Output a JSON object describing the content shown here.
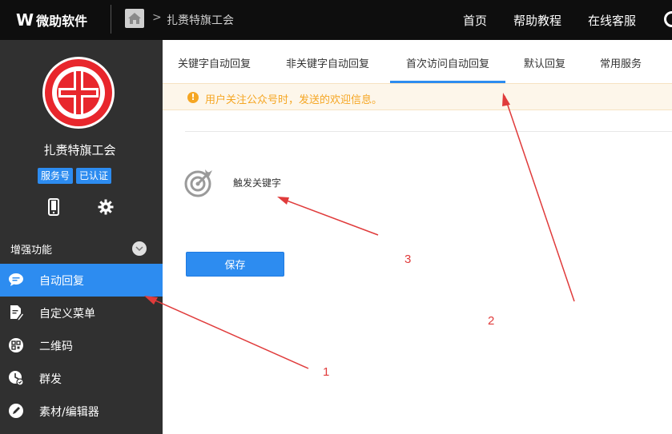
{
  "topbar": {
    "logo_mark": "W",
    "logo_text": "微助软件",
    "breadcrumb_sep": ">",
    "breadcrumb_text": "扎赉特旗工会",
    "nav": [
      "首页",
      "帮助教程",
      "在线客服"
    ]
  },
  "sidebar": {
    "org_name": "扎赉特旗工会",
    "badges": [
      "服务号",
      "已认证"
    ],
    "section_label": "增强功能",
    "menu": [
      {
        "label": "自动回复",
        "icon": "chat-icon",
        "active": true
      },
      {
        "label": "自定义菜单",
        "icon": "edit-doc-icon",
        "active": false
      },
      {
        "label": "二维码",
        "icon": "qrcode-icon",
        "active": false
      },
      {
        "label": "群发",
        "icon": "clock-send-icon",
        "active": false
      },
      {
        "label": "素材/编辑器",
        "icon": "pencil-icon",
        "active": false
      }
    ]
  },
  "tabs": [
    {
      "label": "关键字自动回复",
      "active": false
    },
    {
      "label": "非关键字自动回复",
      "active": false
    },
    {
      "label": "首次访问自动回复",
      "active": true
    },
    {
      "label": "默认回复",
      "active": false
    },
    {
      "label": "常用服务",
      "active": false
    }
  ],
  "notice": {
    "icon": "!",
    "text": "用户关注公众号时，发送的欢迎信息。"
  },
  "keyword": {
    "label": "触发关键字"
  },
  "save_label": "保存",
  "annotations": [
    "1",
    "2",
    "3"
  ],
  "colors": {
    "accent": "#2d8cf0",
    "topbar_bg": "#0e0e0e",
    "sidebar_bg": "#303030",
    "warning": "#f5a623",
    "annotation": "#e03b3b"
  }
}
